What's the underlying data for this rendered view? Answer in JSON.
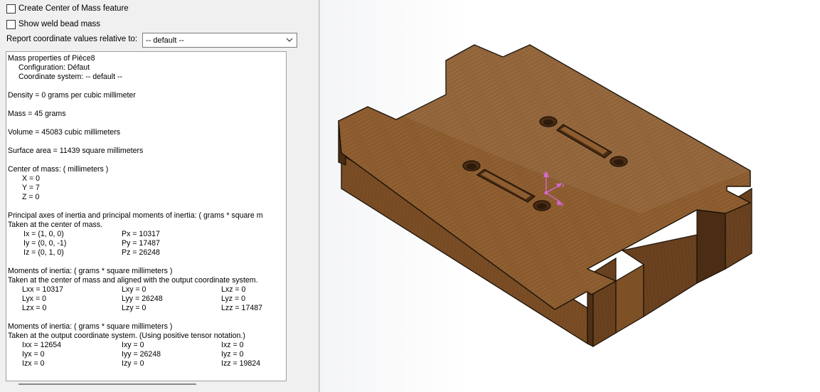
{
  "options": {
    "create_com_label": "Create Center of Mass feature",
    "show_weld_label": "Show weld bead mass",
    "report_relative_label": "Report coordinate values relative to:",
    "report_relative_value": "-- default --"
  },
  "results": {
    "title": "Mass properties of Pièce8",
    "configuration": "Configuration: Défaut",
    "coord_system": "Coordinate system: -- default --",
    "density": "Density = 0 grams per cubic millimeter",
    "mass": "Mass = 45 grams",
    "volume": "Volume = 45083 cubic millimeters",
    "surface_area": "Surface area = 11439  square millimeters",
    "com_header": "Center of mass: ( millimeters )",
    "com_x": "X = 0",
    "com_y": "Y = 7",
    "com_z": "Z = 0",
    "principal_header": "Principal axes of inertia and principal moments of inertia: ( grams *  square m",
    "principal_taken": "Taken at the center of mass.",
    "principal_rows": [
      {
        "axis": "Ix = (1,  0,  0)",
        "moment": "Px = 10317"
      },
      {
        "axis": "Iy = (0,  0, -1)",
        "moment": "Py = 17487"
      },
      {
        "axis": "Iz = (0,  1,  0)",
        "moment": "Pz = 26248"
      }
    ],
    "moi_com_header": "Moments of inertia: ( grams *  square millimeters )",
    "moi_com_taken": "Taken at the center of mass and aligned with the output coordinate system.",
    "moi_com_rows": [
      [
        "Lxx = 10317",
        "Lxy = 0",
        "Lxz = 0"
      ],
      [
        "Lyx = 0",
        "Lyy = 26248",
        "Lyz = 0"
      ],
      [
        "Lzx = 0",
        "Lzy = 0",
        "Lzz = 17487"
      ]
    ],
    "moi_out_header": "Moments of inertia: ( grams *  square millimeters )",
    "moi_out_taken": "Taken at the output coordinate system. (Using positive tensor notation.)",
    "moi_out_rows": [
      [
        "Ixx = 12654",
        "Ixy = 0",
        "Ixz = 0"
      ],
      [
        "Iyx = 0",
        "Iyy = 26248",
        "Iyz = 0"
      ],
      [
        "Izx = 0",
        "Izy = 0",
        "Izz = 19824"
      ]
    ]
  },
  "viewport": {
    "triad_labels": {
      "z": "Iz",
      "y": "Iy",
      "x": "Ix"
    },
    "colors": {
      "wood_top": "#8a5a2e",
      "wood_side_light": "#7a4e27",
      "wood_side_dark": "#5e3a1b",
      "edge": "#1a1208",
      "triad": "#d36ad3"
    }
  }
}
